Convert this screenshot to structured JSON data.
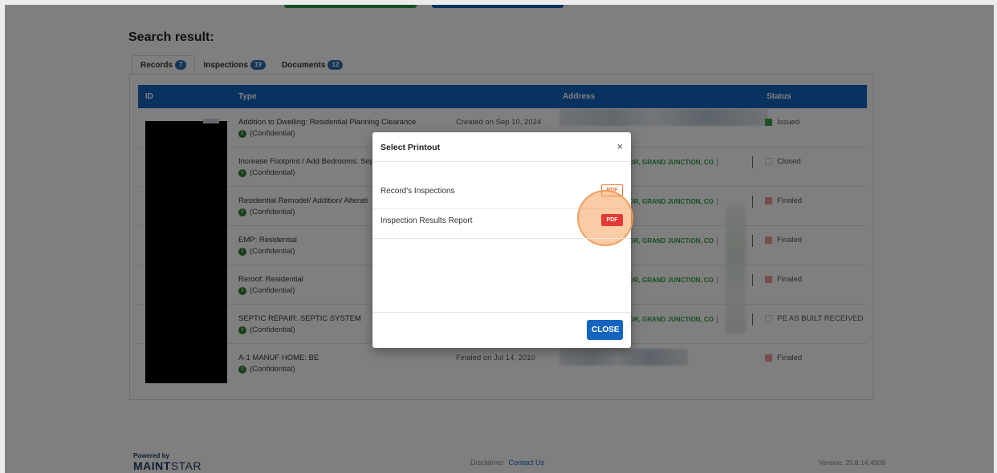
{
  "top_actions": {
    "green_label": "",
    "blue_label": ""
  },
  "page": {
    "title": "Search result:"
  },
  "tabs": [
    {
      "label": "Records",
      "count": "7"
    },
    {
      "label": "Inspections",
      "count": "19"
    },
    {
      "label": "Documents",
      "count": "12"
    }
  ],
  "table": {
    "headers": {
      "id": "ID",
      "type": "Type",
      "address": "Address",
      "status": "Status"
    },
    "confidential": "(Confidential)",
    "rows": [
      {
        "type": "Addition to Dwelling: Residential Planning Clearance",
        "date": "Created on Sep 10, 2024",
        "address": "",
        "status": "Issued",
        "status_color": "#43a047"
      },
      {
        "type": "Increase Footprint / Add Bedrooms: Sep",
        "date": "",
        "address": "DR, GRAND JUNCTION, CO",
        "status": "Closed",
        "status_color": "#e0e0e0"
      },
      {
        "type": "Residential Remodel/ Addition/ Alterati",
        "date": "",
        "address": "DR, GRAND JUNCTION, CO",
        "status": "Finaled",
        "status_color": "#ef9a9a"
      },
      {
        "type": "EMP: Residential",
        "date": "",
        "address": "DR, GRAND JUNCTION, CO",
        "status": "Finaled",
        "status_color": "#ef9a9a"
      },
      {
        "type": "Reroof: Residential",
        "date": "",
        "address": "DR, GRAND JUNCTION, CO",
        "status": "Finaled",
        "status_color": "#ef9a9a"
      },
      {
        "type": "SEPTIC REPAIR: SEPTIC SYSTEM",
        "date": "",
        "address": "DR, GRAND JUNCTION, CO",
        "status": "PE AS BUILT RECEIVED",
        "status_color": "#e0e0e0"
      },
      {
        "type": "A-1 MANUF HOME: BE",
        "date": "Finaled on Jul 14, 2010",
        "address": "",
        "status": "Finaled",
        "status_color": "#ef9a9a"
      }
    ]
  },
  "modal": {
    "title": "Select Printout",
    "close_glyph": "×",
    "items": [
      {
        "label": "Record's Inspections",
        "button": "PDF"
      },
      {
        "label": "Inspection Results Report",
        "button": "PDF"
      }
    ],
    "close_button": "CLOSE"
  },
  "footer": {
    "powered_by": "Powered by",
    "brand_bold": "MAINT",
    "brand_light": "STAR",
    "disclaimer": "Disclaimer",
    "contact": "Contact Us",
    "version": "Version: 25.8.14.4908"
  },
  "colors": {
    "primary": "#1565c0",
    "success": "#2e9f47",
    "pdf": "#e53935"
  }
}
